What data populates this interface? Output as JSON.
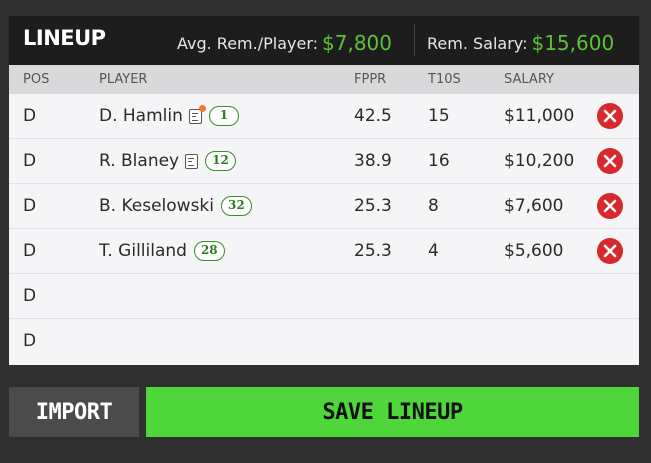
{
  "header": {
    "title": "LINEUP",
    "avg_label": "Avg. Rem./Player:",
    "avg_value": "$7,800",
    "rem_label": "Rem. Salary:",
    "rem_value": "$15,600"
  },
  "columns": {
    "pos": "POS",
    "player": "PLAYER",
    "fppr": "FPPR",
    "t10s": "T10S",
    "salary": "SALARY"
  },
  "rows": [
    {
      "pos": "D",
      "player": "D. Hamlin",
      "note": true,
      "note_alert": true,
      "car": "1",
      "fppr": "42.5",
      "t10s": "15",
      "salary": "$11,000",
      "removable": true
    },
    {
      "pos": "D",
      "player": "R. Blaney",
      "note": true,
      "note_alert": false,
      "car": "12",
      "fppr": "38.9",
      "t10s": "16",
      "salary": "$10,200",
      "removable": true
    },
    {
      "pos": "D",
      "player": "B. Keselowski",
      "note": false,
      "note_alert": false,
      "car": "32",
      "fppr": "25.3",
      "t10s": "8",
      "salary": "$7,600",
      "removable": true
    },
    {
      "pos": "D",
      "player": "T. Gilliland",
      "note": false,
      "note_alert": false,
      "car": "28",
      "fppr": "25.3",
      "t10s": "4",
      "salary": "$5,600",
      "removable": true
    },
    {
      "pos": "D",
      "player": "",
      "note": false,
      "note_alert": false,
      "car": "",
      "fppr": "",
      "t10s": "",
      "salary": "",
      "removable": false
    },
    {
      "pos": "D",
      "player": "",
      "note": false,
      "note_alert": false,
      "car": "",
      "fppr": "",
      "t10s": "",
      "salary": "",
      "removable": false
    }
  ],
  "buttons": {
    "import": "IMPORT",
    "save": "SAVE LINEUP"
  },
  "colors": {
    "accent_green": "#5bc33a",
    "save_green": "#4fd63b",
    "remove_red": "#d9272e",
    "alert_orange": "#f0782a"
  },
  "icons": {
    "remove": "close-circle-icon",
    "note": "player-news-icon"
  }
}
